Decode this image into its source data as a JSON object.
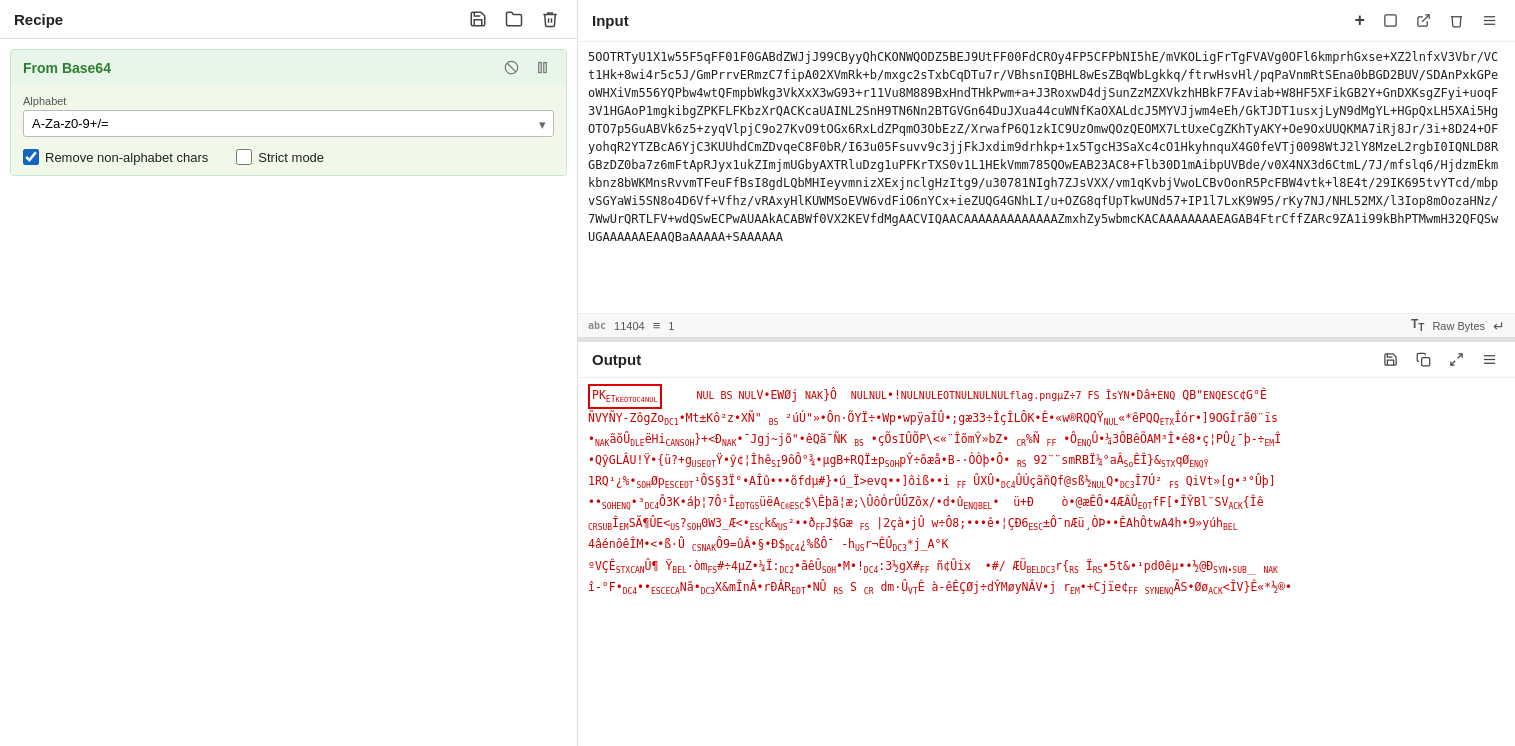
{
  "left_panel": {
    "title": "Recipe",
    "save_label": "💾",
    "folder_label": "📁",
    "trash_label": "🗑",
    "ingredient": {
      "title": "From Base64",
      "alphabet_label": "Alphabet",
      "alphabet_value": "A-Za-z0-9+/=",
      "remove_nonalpha_checked": true,
      "remove_nonalpha_label": "Remove non-alphabet chars",
      "strict_mode_checked": false,
      "strict_mode_label": "Strict mode"
    }
  },
  "right_panel": {
    "input": {
      "title": "Input",
      "char_count": "11404",
      "line_count": "1",
      "format_label": "Raw Bytes",
      "content": "5OOTRTyU1X1w55F5qFF01F0GABdZWJjJ99CByyQhCKONWQODZ5BEJ9UtFF00FdCROy4FP5CFPbNI5hE/mVKOLigFrTgFVAVg0OFL\n6kmprhGxse+XZ2lnfxV3Vbr/VCt1Hk+8wi4r5c5J/GmPrrvERmzC7fipA02XVmRk+b/mxgc2sTxbCqDTu7r/VBhsnIQBHL8\nwEsZBqWbLgkkq/ftrwHsvHl/pqPaVnmRtSEna0bBGD2BUV/SDAnPxkGPeoWHXiVm556YQPbw4wtQFmpbWkg3VkXxX3wG93+\nr11Vu8M889BxHndTHkPwm+a+J3RoxwD4djSunZzMZXVkzhHBkF7FAviab+W8HF5XFikGB2Y+GnDXKsgZFyi+uoqF3V1HGAo\nP1mgkibgZPKFLFKbzXrQACKcaUAINL2SnH9TN6Nn2BTGVGn64DuJXua44cuWNfKaOXALdcJ5MYVJjwm4eEh/GkTJDT1usxj\nLyN9dMgYL+HGpQxLH5XAi5HgOTO7p5GuABVk6z5+zyqVlpjC9o27KvO9tOGx6RxLdZPqmO3ObEzZ/XrwafP6Q1zkIC9UzOm\nwQOzQEOMX7LtUxeCgZKhTyAKY+Oe9OxUUQKMA7iRj8Jr/3i+8D24+OFyohqR2YTZBcA6YjC3KUUhdCmZDvqeC8F0bR/I63u\n05Fsuvv9c3jjFkJxdim9drhkp+1x5TgcH3SaXc4cO1HkyhnquX4G0feVTj0098WtJ2lY8MzeL2rgbI0IQNLD8RGBzDZ0ba7\nz6mFtApRJyx1ukZImjmUGbyAXTRluDzg1uPFKrTXS0v1L1HEkVmm785QOwEAB23AC8+Flb30D1mAibpUVBde/v0X4NX3d6C\ntmL/7J/mfslq6/HjdzmEkmkbnz8bWKMnsRvvmTFeuFfBsI8gdLQbMHIeyvmnizXExjnclgHzItg9/u30781NIgh7ZJsVXX/\nvm1qKvbjVwoLCBvOonR5PcFBW4vtk+l8E4t/29IK695tvYTcd/mbpvSGYaWi5SN8o4D6Vf+Vfhz/vRAxyHlKUWMSoEVW6vd\nFiO6nYCx+ieZUQG4GNhLI/u+OZG8qfUpTkwUNd57+IP1l7LxK9W95/rKy7NJ/NHL52MX/l3Iop8mOozaHNz/7WwUrQRTLFV\n+wdQSwECPwAUAAkACABWf0VX2KEVfdMgAACVIQAACAAAAAAAAAAAAAZmxhZy5wbmcKACAAAAAAAAEAGAB4FtrC\nffZARc9ZA1i99kBhPTMwmH32QFQSwUGAAAAAAEAAQBaAAAAA+SAAAAAA"
    },
    "output": {
      "title": "Output",
      "content_preview": "PK\u0004\u0003\u0014\u0000\t\u0000\u0000\u0000 NUL BS NUL V•EWØj NAK }Ô  NULNUL•!NULNULEOTNULNULNULflag.pngµZ÷7 FS ÎsYN•Dâ+ENQ QB\"ENQESC¢G°Ê\nÑVYÑY-ZôgZoDC1•Mt±Kô²z•XÑ\" BS ²úÚ\"»•Ôn·ÕYÏ÷•Wp•wpÿaÎÛ•;gæ33÷ÎçÎLÔK•Ê•«w®RQQŶNUL«*êPQQETXÎór•]9OGÎrã0¨is\n•NAKãõÛDLEëHiCANSOH}+<ĐNAk•¯Jgj~jõ\"•êQã¯ÑK BS •çÕSIÛÕP\\<«¨ÎõmŶ»bZ•CR%Ñ FF •ÔENqÛ•¼3ÔBêÕAM³Î•é8•ç¦PÛ¿¯þ-÷EMÎ\n•QŷGLÂU!Ÿ•{ü?+gUSEOT Ÿ•ŷ¢¦ÎhêSI9ôÔ°¾•µgB+RQÏ±pSOHpŶ÷õæå•B-·ÒÒþ•Ô•RS92¨¨smRBÏ¼°aÂSoÊÎ}&STXqØENQŶ\n1RQ¹¿%•SOHØpESCEOT¹ÔS§3Ï°•AÎû•••õfdµ#}•ú_Ï>evq••]ôiß••i FF ÛXÛ•DC4ÛÚçãñQf@sß½NULQ•DC3Î7Ú² FS QiVt»[g•³°Ûþ]\n••SOHENQ•³DC4Ô3K•áþ¦7Ô¹ÎEOTGSüëAC®ESC$\\Êþã¦æ;\\ÛôÓrÛÛZõx/•d•ûENQBEL•  ü+Đ    ò•@æÊÔ•4ÆÂÛEOTfF[•ÎŶBl¨SVACk{Îê\nCRSUBÎEMSÃ¶ÛE<US?SOH0W3_Æ<•ESCk&US²••ðFFJ$Gæ FS |2çà•jÛ w÷Ô8;•••ê•¦ÇÐ6ESC±Ô¯nÆü¸ÒÞ••ÊAhÔtwA4h•9»yúhBEL\n4âénôêÎM•<•ß·Û CSNAKÔ9=ûÂ•§•Đ$DC4¿%ßÔ¯-hUSr¬ÊÛDc3*j_A°K\nºVÇÊSTXCANÛ¶ ŸBEL·òmFS#÷4µZ•¼Ï:DC2•ãêÛSOH•M•!DC4:3½gX#FF ñ¢Ûix  •#/ ÆÜBELDc3r{RS ÏRS•5t&•¹pd0êµ••½@ÐSYN•SUB__ NAK\nî-°F•DC4••ESCECANã•DC3X&mÎnÂ•rĐÂREOT•NÛ RS S CR dm·ÛVTÊ à-êÊÇØj÷dŶMøyNÂV•j rEM•+Cjïe¢FF SYNENQÃS•ØøACK<ÎV}Ê«*½®•"
    }
  }
}
